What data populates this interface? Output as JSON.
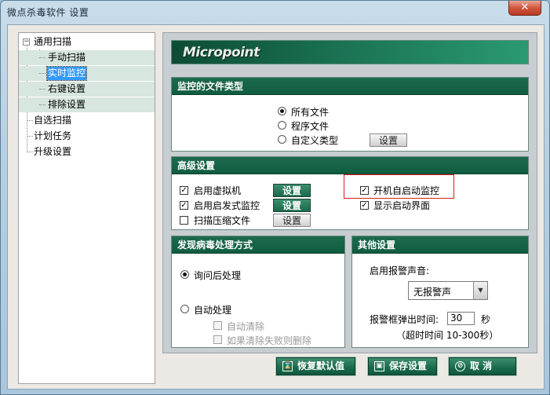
{
  "window": {
    "title": "微点杀毒软件  设置",
    "close_label": "✕"
  },
  "tree": {
    "root": "通用扫描",
    "children": [
      "手动扫描",
      "实时监控",
      "右键设置",
      "排除设置"
    ],
    "selected_child": "实时监控",
    "others": [
      "自选扫描",
      "计划任务",
      "升级设置"
    ],
    "expander": "−"
  },
  "banner": {
    "logo": "Micropoint"
  },
  "file_types": {
    "header": "监控的文件类型",
    "options": [
      "所有文件",
      "程序文件",
      "自定义类型"
    ],
    "selected": "所有文件",
    "set_label": "设置"
  },
  "advanced": {
    "header": "高级设置",
    "left": [
      {
        "label": "启用虚拟机",
        "checked": true,
        "button": "设置"
      },
      {
        "label": "启用启发式监控",
        "checked": true,
        "button": "设置"
      },
      {
        "label": "扫描压缩文件",
        "checked": false,
        "button": "设置"
      }
    ],
    "right": [
      {
        "label": "开机自启动监控",
        "checked": true
      },
      {
        "label": "显示启动界面",
        "checked": true
      }
    ],
    "check_mark": "✓"
  },
  "virus_action": {
    "header": "发现病毒处理方式",
    "ask": "询问后处理",
    "auto": "自动处理",
    "selected": "询问后处理",
    "sub": [
      "自动清除",
      "如果清除失败则删除"
    ]
  },
  "other": {
    "header": "其他设置",
    "alarm_label": "启用报警声音:",
    "alarm_value": "无报警声",
    "alarm_arrow": "▼",
    "timeout_label": "报警框弹出时间:",
    "timeout_value": "30",
    "timeout_unit": "秒",
    "timeout_hint": "（超时时间 10-300秒）"
  },
  "footer": {
    "restore": {
      "label": "恢复默认值",
      "icon": "hourglass-icon",
      "glyph": "⌛"
    },
    "save": {
      "label": "保存设置",
      "icon": "save-icon",
      "glyph": "▣"
    },
    "cancel": {
      "label": "取  消",
      "icon": "cancel-icon",
      "glyph": "⊘"
    }
  },
  "colors": {
    "accent_green": "#186a4b",
    "highlight_red": "#d52020",
    "selection_blue": "#3399ff"
  }
}
